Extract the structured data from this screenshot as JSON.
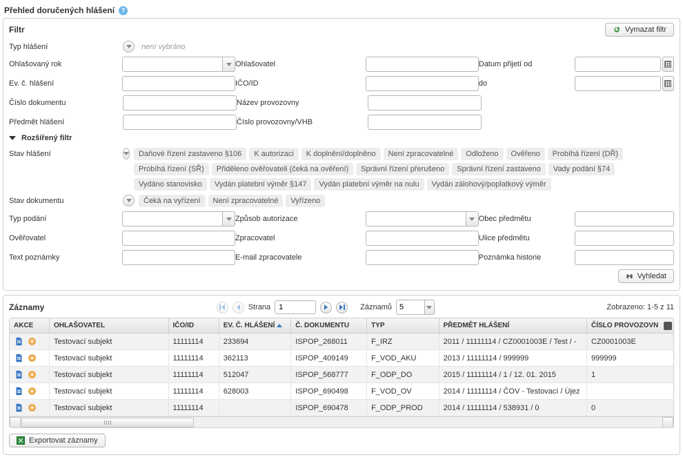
{
  "page_title": "Přehled doručených hlášení",
  "filter": {
    "header": "Filtr",
    "clear_button": "Vymazat filtr",
    "labels": {
      "typ_hlaseni": "Typ hlášení",
      "ohlasovany_rok": "Ohlašovaný rok",
      "ev_c_hlaseni": "Ev. č. hlášení",
      "cislo_dokumentu": "Číslo dokumentu",
      "predmet_hlaseni": "Předmět hlášení",
      "ohlasovatel": "Ohlašovatel",
      "ico_id": "IČO/ID",
      "nazev_provozovny": "Název provozovny",
      "cislo_provozovny_vhb": "Číslo provozovny/VHB",
      "datum_prijeti_od": "Datum přijetí od",
      "do": "do"
    },
    "typ_hlaseni_placeholder": "není vybráno"
  },
  "ext_filter": {
    "header": "Rozšířený filtr",
    "stav_hlaseni_label": "Stav hlášení",
    "stav_hlaseni_tags": [
      "Daňové řízení zastaveno §106",
      "K autorizaci",
      "K doplnění/doplněno",
      "Není zpracovatelné",
      "Odloženo",
      "Ověřeno",
      "Probíhá řízení (DŘ)",
      "Probíhá řízení (SŘ)",
      "Přiděleno ověřovateli (čeká na ověření)",
      "Správní řízení přerušeno",
      "Správní řízení zastaveno",
      "Vady podání §74",
      "Vydáno stanovisko",
      "Vydán platební výměr §147",
      "Vydán platební výměr na nulu",
      "Vydán zálohový/poplatkový výměr"
    ],
    "stav_dokumentu_label": "Stav dokumentu",
    "stav_dokumentu_tags": [
      "Čeká na vyřízení",
      "Není zpracovatelné",
      "Vyřízeno"
    ],
    "labels": {
      "typ_podani": "Typ podání",
      "overovatel": "Ověřovatel",
      "text_poznamky": "Text poznámky",
      "zpusob_autorizace": "Způsob autorizace",
      "zpracovatel": "Zpracovatel",
      "email_zpracovatele": "E-mail zpracovatele",
      "obec_predmetu": "Obec předmětu",
      "ulice_predmetu": "Ulice předmětu",
      "poznamka_historie": "Poznámka historie"
    },
    "search_button": "Vyhledat"
  },
  "records": {
    "header": "Záznamy",
    "page_label": "Strana",
    "page_value": "1",
    "per_page_label": "Záznamů",
    "per_page_value": "5",
    "shown_label": "Zobrazeno: 1-5 z 11",
    "columns": {
      "akce": "Akce",
      "ohlasovatel": "Ohlašovatel",
      "ico_id": "IČO/ID",
      "ev_c_hlaseni": "Ev. č. hlášení",
      "c_dokumentu": "Č. dokumentu",
      "typ": "Typ",
      "predmet_hlaseni": "Předmět hlášení",
      "cislo_provozovny": "Číslo provozovn"
    },
    "rows": [
      {
        "ohlasovatel": "Testovací subjekt",
        "ico": "11111114",
        "evc": "233694",
        "doc": "ISPOP_268011",
        "typ": "F_IRZ",
        "predmet": "2011 / 11111114 / CZ0001003E / Test / -",
        "prov": "CZ0001003E"
      },
      {
        "ohlasovatel": "Testovací subjekt",
        "ico": "11111114",
        "evc": "362113",
        "doc": "ISPOP_409149",
        "typ": "F_VOD_AKU",
        "predmet": "2013 / 11111114 / 999999",
        "prov": "999999"
      },
      {
        "ohlasovatel": "Testovací subjekt",
        "ico": "11111114",
        "evc": "512047",
        "doc": "ISPOP_568777",
        "typ": "F_ODP_DO",
        "predmet": "2015 / 11111114 / 1 / 12. 01. 2015",
        "prov": "1"
      },
      {
        "ohlasovatel": "Testovací subjekt",
        "ico": "11111114",
        "evc": "628003",
        "doc": "ISPOP_690498",
        "typ": "F_VOD_OV",
        "predmet": "2014 / 11111114 / ČOV - Testovací / Újez",
        "prov": ""
      },
      {
        "ohlasovatel": "Testovací subjekt",
        "ico": "11111114",
        "evc": "",
        "doc": "ISPOP_690478",
        "typ": "F_ODP_PROD",
        "predmet": "2014 / 11111114 / 538931 / 0",
        "prov": "0"
      }
    ]
  },
  "export_button": "Exportovat záznamy"
}
